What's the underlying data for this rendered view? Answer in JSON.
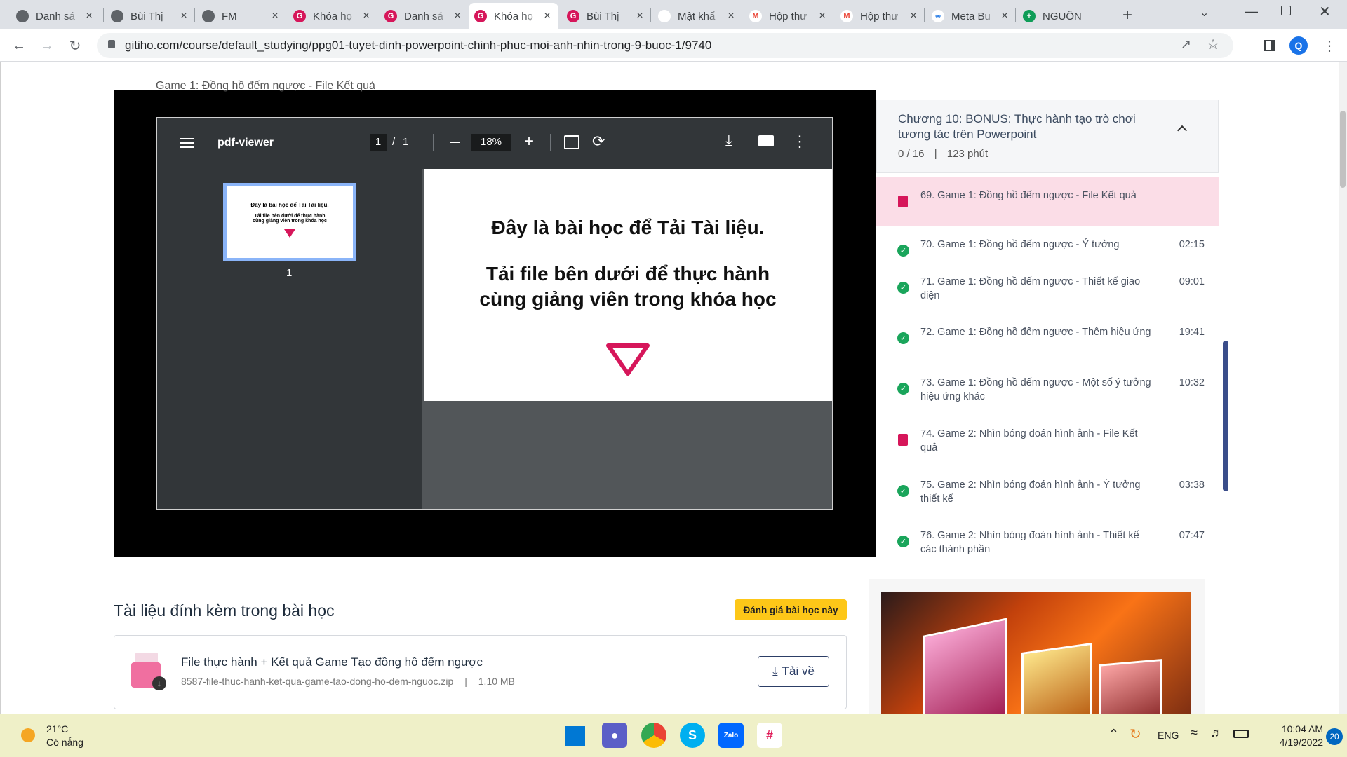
{
  "tabs": [
    {
      "title": "Danh sá",
      "icon": "globe-icon"
    },
    {
      "title": "Bùi Thị",
      "icon": "globe-icon"
    },
    {
      "title": "FM",
      "icon": "globe-icon"
    },
    {
      "title": "Khóa họ",
      "icon": "gitiho-icon"
    },
    {
      "title": "Danh sá",
      "icon": "gitiho-icon"
    },
    {
      "title": "Khóa họ",
      "icon": "gitiho-icon",
      "active": true
    },
    {
      "title": "Bùi Thị",
      "icon": "gitiho-icon"
    },
    {
      "title": "Mật khẩ",
      "icon": "gitiho-small-icon"
    },
    {
      "title": "Hộp thư",
      "icon": "gmail-icon"
    },
    {
      "title": "Hộp thư",
      "icon": "gmail-icon"
    },
    {
      "title": "Meta Bu",
      "icon": "meta-icon"
    },
    {
      "title": "NGUỒN",
      "icon": "sheets-icon"
    }
  ],
  "browser": {
    "url": "gitiho.com/course/default_studying/ppg01-tuyet-dinh-powerpoint-chinh-phuc-moi-anh-nhin-trong-9-buoc-1/9740",
    "profile_initial": "Q"
  },
  "top_partial_text": "Game 1: Đồng hồ đếm ngược - File Kết quả",
  "pdf": {
    "title": "pdf-viewer",
    "page_current": "1",
    "page_sep": "/",
    "page_total": "1",
    "zoom": "18%",
    "thumb_number": "1",
    "page_line1": "Đây là bài học để Tải Tài liệu.",
    "page_line2": "Tải file bên dưới để thực hành",
    "page_line3": "cùng giảng viên trong khóa học"
  },
  "chapter": {
    "label": "Chương 10:",
    "title": "BONUS: Thực hành tạo trò chơi tương tác trên Powerpoint",
    "progress": "0 / 16",
    "sep": "|",
    "duration": "123 phút"
  },
  "lessons": [
    {
      "title": "69. Game 1: Đồng hồ đếm ngược - File Kết quả",
      "duration": "",
      "type": "doc",
      "active": true
    },
    {
      "title": "70. Game 1: Đồng hồ đếm ngược - Ý tưởng",
      "duration": "02:15",
      "type": "done"
    },
    {
      "title": "71. Game 1: Đồng hồ đếm ngược - Thiết kế giao diện",
      "duration": "09:01",
      "type": "done"
    },
    {
      "title": "72. Game 1: Đồng hồ đếm ngược - Thêm hiệu ứng",
      "duration": "19:41",
      "type": "done"
    },
    {
      "title": "73. Game 1: Đồng hồ đếm ngược - Một số ý tưởng hiệu ứng khác",
      "duration": "10:32",
      "type": "done"
    },
    {
      "title": "74. Game 2: Nhìn bóng đoán hình ảnh - File Kết quả",
      "duration": "",
      "type": "doc"
    },
    {
      "title": "75. Game 2: Nhìn bóng đoán hình ảnh - Ý tưởng thiết kế",
      "duration": "03:38",
      "type": "done"
    },
    {
      "title": "76. Game 2: Nhìn bóng đoán hình ảnh - Thiết kế các thành phần",
      "duration": "07:47",
      "type": "done"
    }
  ],
  "attachments": {
    "heading": "Tài liệu đính kèm trong bài học",
    "rate_button": "Đánh giá bài học này",
    "file_title": "File thực hành + Kết quả Game Tạo đồng hồ đếm ngược",
    "file_name": "8587-file-thuc-hanh-ket-qua-game-tao-dong-ho-dem-nguoc.zip",
    "file_sep": "|",
    "file_size": "1.10 MB",
    "download_label": "Tải về"
  },
  "taskbar": {
    "temp": "21°C",
    "weather": "Có nắng",
    "lang": "ENG",
    "time": "10:04 AM",
    "date": "4/19/2022",
    "notif_count": "20"
  },
  "colors": {
    "accent": "#d6165a",
    "done": "#1aa55b",
    "active_lesson_bg": "#fbdde7",
    "rate_button": "#fdc718"
  }
}
